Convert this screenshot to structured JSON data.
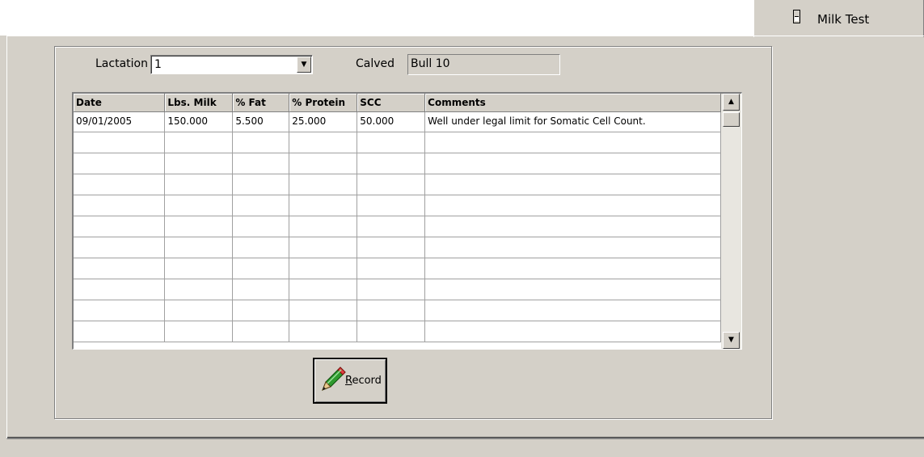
{
  "tab": {
    "label": "Milk Test",
    "icon": "milk-bottle-icon"
  },
  "lactation": {
    "label": "Lactation",
    "value": "1"
  },
  "calved": {
    "label": "Calved",
    "value": "Bull 10"
  },
  "grid": {
    "columns": [
      "Date",
      "Lbs. Milk",
      "% Fat",
      "% Protein",
      "SCC",
      "Comments"
    ],
    "rows": [
      [
        "09/01/2005",
        "150.000",
        "5.500",
        "25.000",
        "50.000",
        "Well under legal limit for Somatic Cell Count."
      ],
      [
        "",
        "",
        "",
        "",
        "",
        ""
      ],
      [
        "",
        "",
        "",
        "",
        "",
        ""
      ],
      [
        "",
        "",
        "",
        "",
        "",
        ""
      ],
      [
        "",
        "",
        "",
        "",
        "",
        ""
      ],
      [
        "",
        "",
        "",
        "",
        "",
        ""
      ],
      [
        "",
        "",
        "",
        "",
        "",
        ""
      ],
      [
        "",
        "",
        "",
        "",
        "",
        ""
      ],
      [
        "",
        "",
        "",
        "",
        "",
        ""
      ],
      [
        "",
        "",
        "",
        "",
        "",
        ""
      ],
      [
        "",
        "",
        "",
        "",
        "",
        ""
      ]
    ]
  },
  "record_button": {
    "accel": "R",
    "rest": "ecord",
    "icon": "pencil-icon"
  }
}
